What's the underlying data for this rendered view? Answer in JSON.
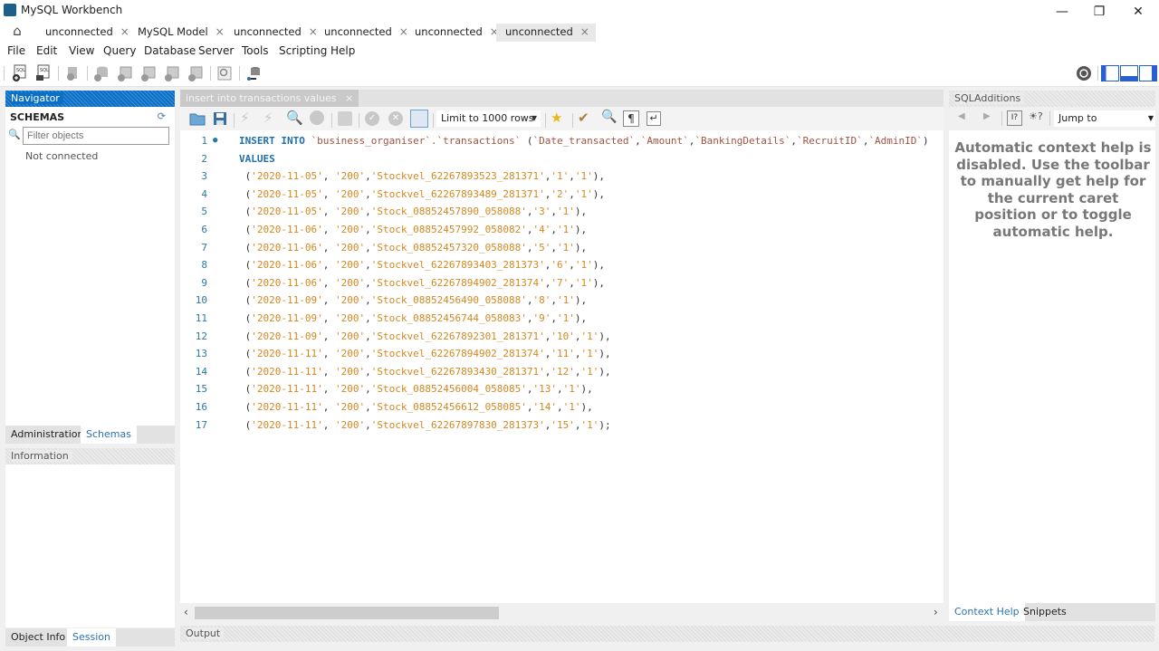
{
  "window": {
    "title": "MySQL Workbench",
    "controls": {
      "minimize": "—",
      "maximize": "❐",
      "close": "✕"
    }
  },
  "tabs": [
    {
      "label": "unconnected",
      "close": "×"
    },
    {
      "label": "MySQL Model",
      "close": "×"
    },
    {
      "label": "unconnected",
      "close": "×"
    },
    {
      "label": "unconnected",
      "close": "×"
    },
    {
      "label": "unconnected",
      "close": "×"
    },
    {
      "label": "unconnected",
      "close": "×",
      "active": true
    }
  ],
  "menu": [
    "File",
    "Edit",
    "View",
    "Query",
    "Database",
    "Server",
    "Tools",
    "Scripting",
    "Help"
  ],
  "navigator": {
    "header": "Navigator",
    "schemas_label": "SCHEMAS",
    "filter_placeholder": "Filter objects",
    "status": "Not connected",
    "tabs": [
      "Administration",
      "Schemas"
    ],
    "active_tab": "Schemas"
  },
  "information": {
    "header": "Information",
    "tabs": [
      "Object Info",
      "Session"
    ],
    "active_tab": "Session"
  },
  "editor": {
    "tab_label": "insert into transactions  values",
    "tab_close": "×",
    "limit_rows": "Limit to 1000 rows",
    "lines": [
      {
        "n": "1",
        "marker": true,
        "kind": "insert",
        "keyword1": "INSERT INTO",
        "table": "`business_organiser`.`transactions`",
        "columns": [
          "`Date_transacted`",
          "`Amount`",
          "`BankingDetails`",
          "`RecruitID`",
          "`AdminID`"
        ]
      },
      {
        "n": "2",
        "kind": "keyword",
        "text": "VALUES"
      },
      {
        "n": "3",
        "kind": "row",
        "vals": [
          "'2020-11-05'",
          "'200'",
          "'Stockvel_62267893523_281371'",
          "'1'",
          "'1'"
        ],
        "end": ","
      },
      {
        "n": "4",
        "kind": "row",
        "vals": [
          "'2020-11-05'",
          "'200'",
          "'Stockvel_62267893489_281371'",
          "'2'",
          "'1'"
        ],
        "end": ","
      },
      {
        "n": "5",
        "kind": "row",
        "vals": [
          "'2020-11-05'",
          "'200'",
          "'Stock_08852457890_058088'",
          "'3'",
          "'1'"
        ],
        "end": ","
      },
      {
        "n": "6",
        "kind": "row",
        "vals": [
          "'2020-11-06'",
          "'200'",
          "'Stock_08852457992_058082'",
          "'4'",
          "'1'"
        ],
        "end": ","
      },
      {
        "n": "7",
        "kind": "row",
        "vals": [
          "'2020-11-06'",
          "'200'",
          "'Stock_08852457320_058088'",
          "'5'",
          "'1'"
        ],
        "end": ","
      },
      {
        "n": "8",
        "kind": "row",
        "vals": [
          "'2020-11-06'",
          "'200'",
          "'Stockvel_62267893403_281373'",
          "'6'",
          "'1'"
        ],
        "end": ","
      },
      {
        "n": "9",
        "kind": "row",
        "vals": [
          "'2020-11-06'",
          "'200'",
          "'Stockvel_62267894902_281374'",
          "'7'",
          "'1'"
        ],
        "end": ","
      },
      {
        "n": "10",
        "kind": "row",
        "vals": [
          "'2020-11-09'",
          "'200'",
          "'Stock_08852456490_058088'",
          "'8'",
          "'1'"
        ],
        "end": ","
      },
      {
        "n": "11",
        "kind": "row",
        "vals": [
          "'2020-11-09'",
          "'200'",
          "'Stock_08852456744_058083'",
          "'9'",
          "'1'"
        ],
        "end": ","
      },
      {
        "n": "12",
        "kind": "row",
        "vals": [
          "'2020-11-09'",
          "'200'",
          "'Stockvel_62267892301_281371'",
          "'10'",
          "'1'"
        ],
        "end": ","
      },
      {
        "n": "13",
        "kind": "row",
        "vals": [
          "'2020-11-11'",
          "'200'",
          "'Stockvel_62267894902_281374'",
          "'11'",
          "'1'"
        ],
        "end": ","
      },
      {
        "n": "14",
        "kind": "row",
        "vals": [
          "'2020-11-11'",
          "'200'",
          "'Stockvel_62267893430_281371'",
          "'12'",
          "'1'"
        ],
        "end": ","
      },
      {
        "n": "15",
        "kind": "row",
        "vals": [
          "'2020-11-11'",
          "'200'",
          "'Stock_08852456004_058085'",
          "'13'",
          "'1'"
        ],
        "end": ","
      },
      {
        "n": "16",
        "kind": "row",
        "vals": [
          "'2020-11-11'",
          "'200'",
          "'Stock_08852456612_058085'",
          "'14'",
          "'1'"
        ],
        "end": ","
      },
      {
        "n": "17",
        "kind": "row",
        "vals": [
          "'2020-11-11'",
          "'200'",
          "'Stockvel_62267897830_281373'",
          "'15'",
          "'1'"
        ],
        "end": ";"
      }
    ]
  },
  "output": {
    "header": "Output"
  },
  "sql_additions": {
    "header": "SQLAdditions",
    "jump_to": "Jump to",
    "help_text": "Automatic context help is disabled. Use the toolbar to manually get help for the current caret position or to toggle automatic help.",
    "tabs": [
      "Context Help",
      "Snippets"
    ],
    "active_tab": "Context Help"
  },
  "colors": {
    "accent": "#0c6fc6",
    "keyword": "#1d6fb0",
    "string": "#d48820",
    "identifier": "#a4523d",
    "line_number": "#2a7aa5"
  }
}
